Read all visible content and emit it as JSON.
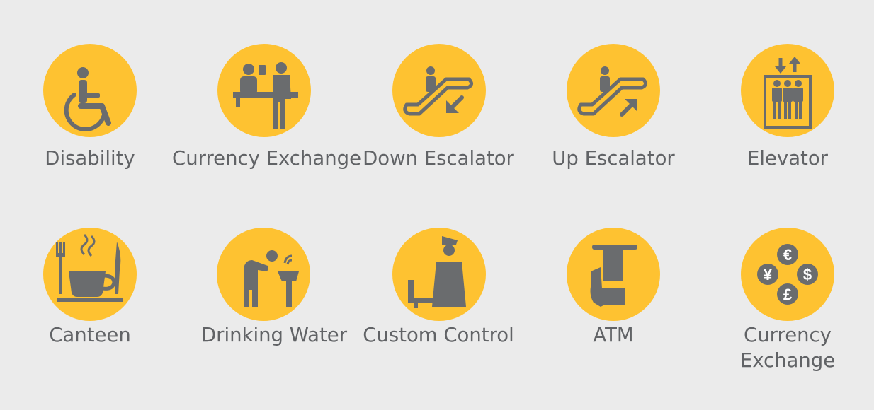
{
  "palette": {
    "background": "#ebebeb",
    "circle": "#fec231",
    "glyph": "#6a6c6e",
    "text": "#616366"
  },
  "rows": [
    {
      "items": [
        {
          "icon": "disability-icon",
          "label": "Disability"
        },
        {
          "icon": "currency-exchange-desk-icon",
          "label": "Currency Exchange"
        },
        {
          "icon": "down-escalator-icon",
          "label": "Down Escalator"
        },
        {
          "icon": "up-escalator-icon",
          "label": "Up Escalator"
        },
        {
          "icon": "elevator-icon",
          "label": "Elevator"
        }
      ]
    },
    {
      "items": [
        {
          "icon": "canteen-icon",
          "label": "Canteen"
        },
        {
          "icon": "drinking-water-icon",
          "label": "Drinking Water"
        },
        {
          "icon": "custom-control-icon",
          "label": "Custom Control"
        },
        {
          "icon": "atm-icon",
          "label": "ATM"
        },
        {
          "icon": "currency-symbols-icon",
          "label_line1": "Currency",
          "label_line2": "Exchange",
          "symbols": {
            "euro": "€",
            "yen": "¥",
            "dollar": "$",
            "pound": "£"
          }
        }
      ]
    }
  ]
}
